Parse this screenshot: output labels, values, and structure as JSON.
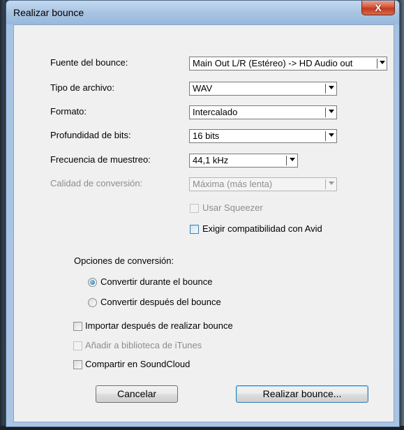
{
  "window": {
    "title": "Realizar bounce",
    "close_glyph": "X"
  },
  "form": {
    "bounce_source": {
      "label": "Fuente del bounce:",
      "value": "Main Out L/R (Estéreo) -> HD Audio out"
    },
    "file_type": {
      "label": "Tipo de archivo:",
      "value": "WAV"
    },
    "format": {
      "label": "Formato:",
      "value": "Intercalado"
    },
    "bit_depth": {
      "label": "Profundidad de bits:",
      "value": "16 bits"
    },
    "sample_rate": {
      "label": "Frecuencia de muestreo:",
      "value": "44,1 kHz"
    },
    "conversion_quality": {
      "label": "Calidad de conversión:",
      "value": "Máxima (más lenta)"
    }
  },
  "checks": {
    "use_squeezer": {
      "label": "Usar Squeezer",
      "checked": false,
      "enabled": false
    },
    "avid_compat": {
      "label": "Exigir compatibilidad con Avid",
      "checked": false,
      "enabled": true
    }
  },
  "conversion": {
    "heading": "Opciones de conversión:",
    "options": [
      {
        "label": "Convertir durante el bounce",
        "selected": true
      },
      {
        "label": "Convertir después del bounce",
        "selected": false
      }
    ]
  },
  "post": {
    "import_after": {
      "label": "Importar después de realizar bounce",
      "checked": false,
      "enabled": true
    },
    "add_itunes": {
      "label": "Añadir a biblioteca de iTunes",
      "checked": false,
      "enabled": false
    },
    "share_soundcloud": {
      "label": "Compartir en SoundCloud",
      "checked": false,
      "enabled": true
    }
  },
  "buttons": {
    "cancel": "Cancelar",
    "bounce": "Realizar bounce..."
  },
  "colors": {
    "title_bar": "#a9c4e2",
    "close_button": "#c23b20",
    "dialog_face": "#f0f0f0",
    "disabled_text": "#8d8d8d",
    "radio_accent": "#1f6fb5"
  },
  "icons": {
    "close": "close-icon",
    "dropdown": "chevron-down-icon"
  }
}
